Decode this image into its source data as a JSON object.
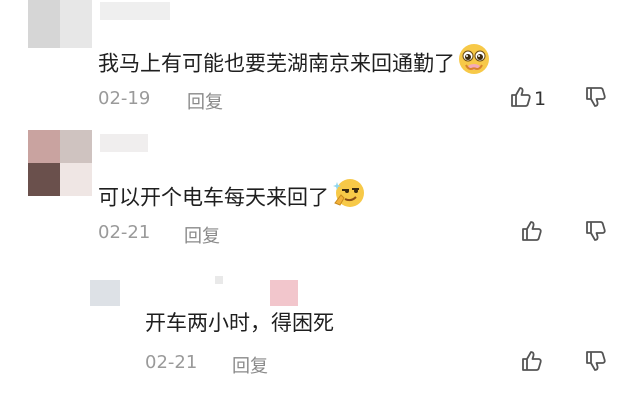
{
  "comments": [
    {
      "text": "我马上有可能也要芜湖南京来回通勤了",
      "date": "02-19",
      "reply_label": "回复",
      "like_count": "1",
      "emoji": "pleading-emoji"
    },
    {
      "text": "可以开个电车每天来回了",
      "date": "02-21",
      "reply_label": "回复",
      "emoji": "smug-emoji"
    },
    {
      "text": "开车两小时，得困死",
      "date": "02-21",
      "reply_label": "回复"
    }
  ],
  "icons": {
    "like": "thumbs-up-icon",
    "dislike": "thumbs-down-icon"
  },
  "colors": {
    "meta_gray": "#9a9a9a",
    "icon_gray": "#555555",
    "emoji_yellow": "#f7c948"
  }
}
